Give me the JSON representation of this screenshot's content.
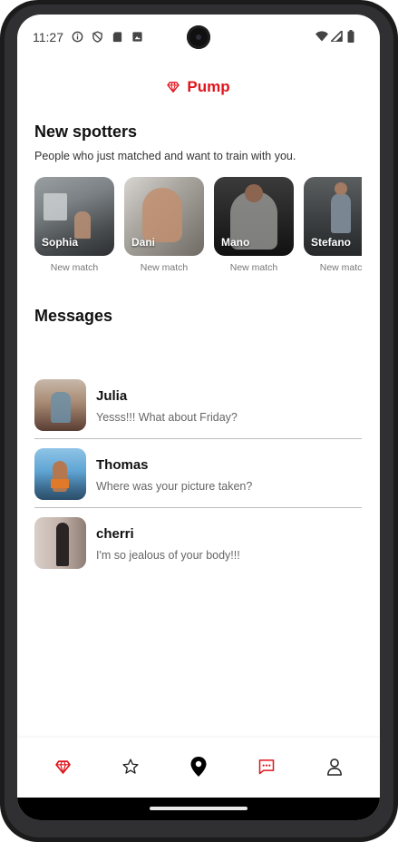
{
  "status_bar": {
    "time": "11:27"
  },
  "app": {
    "title": "Pump",
    "accent_color": "#e0141c"
  },
  "spotters_section": {
    "title": "New spotters",
    "subtitle": "People who just matched and want to train with you.",
    "items": [
      {
        "name": "Sophia",
        "caption": "New match"
      },
      {
        "name": "Dani",
        "caption": "New match"
      },
      {
        "name": "Mano",
        "caption": "New match"
      },
      {
        "name": "Stefano",
        "caption": "New match"
      }
    ]
  },
  "messages_section": {
    "title": "Messages",
    "items": [
      {
        "name": "Julia",
        "preview": "Yesss!!! What about Friday?"
      },
      {
        "name": "Thomas",
        "preview": "Where was your picture taken?"
      },
      {
        "name": "cherri",
        "preview": "I'm so jealous of your body!!!"
      }
    ]
  },
  "bottom_nav": {
    "items": [
      {
        "icon": "gem-icon",
        "active": true,
        "color": "#e0141c"
      },
      {
        "icon": "star-icon",
        "active": false,
        "color": "#222222"
      },
      {
        "icon": "map-pin-icon",
        "active": false,
        "color": "#000000"
      },
      {
        "icon": "chat-icon",
        "active": true,
        "color": "#e0141c"
      },
      {
        "icon": "profile-icon",
        "active": false,
        "color": "#222222"
      }
    ]
  }
}
